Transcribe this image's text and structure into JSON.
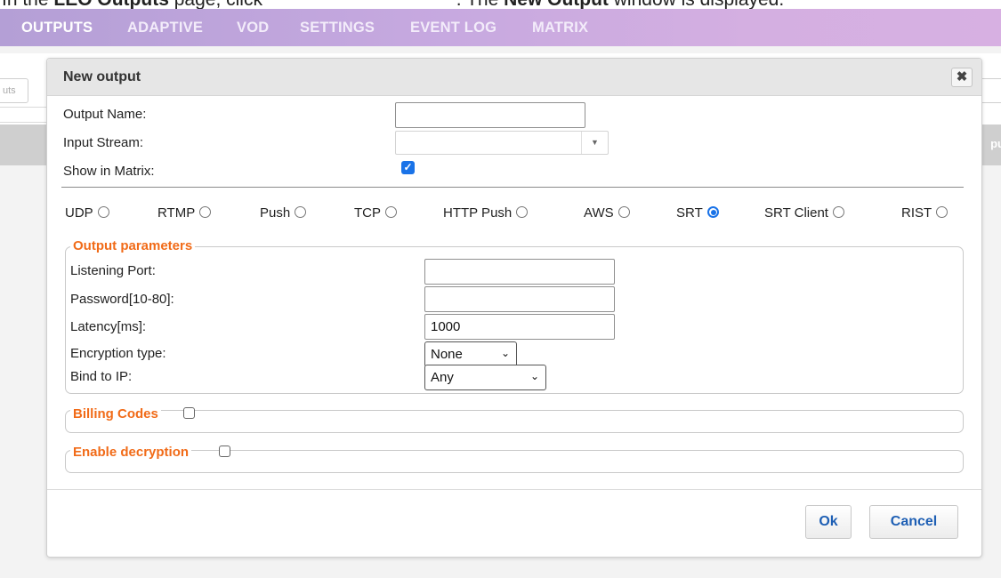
{
  "doc_caption": {
    "prefix": "In the ",
    "bold1": "LEO Outputs",
    "mid": " page, click ",
    "suffix": ". The ",
    "bold2": "New Output",
    "end": " window is displayed."
  },
  "nav": {
    "tabs": [
      "OUTPUTS",
      "ADAPTIVE",
      "VOD",
      "SETTINGS",
      "EVENT LOG",
      "MATRIX"
    ]
  },
  "background": {
    "search_placeholder": "uts",
    "header_peek": "pu"
  },
  "dialog": {
    "title": "New output",
    "close_glyph": "✖",
    "fields": {
      "output_name": {
        "label": "Output Name:",
        "value": ""
      },
      "input_stream": {
        "label": "Input Stream:",
        "value": ""
      },
      "show_in_matrix": {
        "label": "Show in Matrix:",
        "checked": true
      }
    },
    "protocols": [
      {
        "label": "UDP",
        "selected": false
      },
      {
        "label": "RTMP",
        "selected": false
      },
      {
        "label": "Push",
        "selected": false
      },
      {
        "label": "TCP",
        "selected": false
      },
      {
        "label": "HTTP Push",
        "selected": false
      },
      {
        "label": "AWS",
        "selected": false
      },
      {
        "label": "SRT",
        "selected": true
      },
      {
        "label": "SRT Client",
        "selected": false
      },
      {
        "label": "RIST",
        "selected": false
      }
    ],
    "output_parameters": {
      "legend": "Output parameters",
      "listening_port": {
        "label": "Listening Port:",
        "value": ""
      },
      "password": {
        "label": "Password[10-80]:",
        "value": ""
      },
      "latency": {
        "label": "Latency[ms]:",
        "value": "1000"
      },
      "encryption_type": {
        "label": "Encryption type:",
        "value": "None"
      },
      "bind_to_ip": {
        "label": "Bind to IP:",
        "value": "Any"
      }
    },
    "billing_codes": {
      "legend": "Billing Codes",
      "checked": false
    },
    "enable_decryption": {
      "legend": "Enable decryption",
      "checked": false
    },
    "buttons": {
      "ok": "Ok",
      "cancel": "Cancel"
    }
  },
  "colors": {
    "accent_blue": "#1a73e8",
    "legend_orange": "#f16b18",
    "button_text": "#1e5fb4",
    "nav_gradient_start": "#b49fd6",
    "nav_gradient_end": "#d7b0e2"
  }
}
